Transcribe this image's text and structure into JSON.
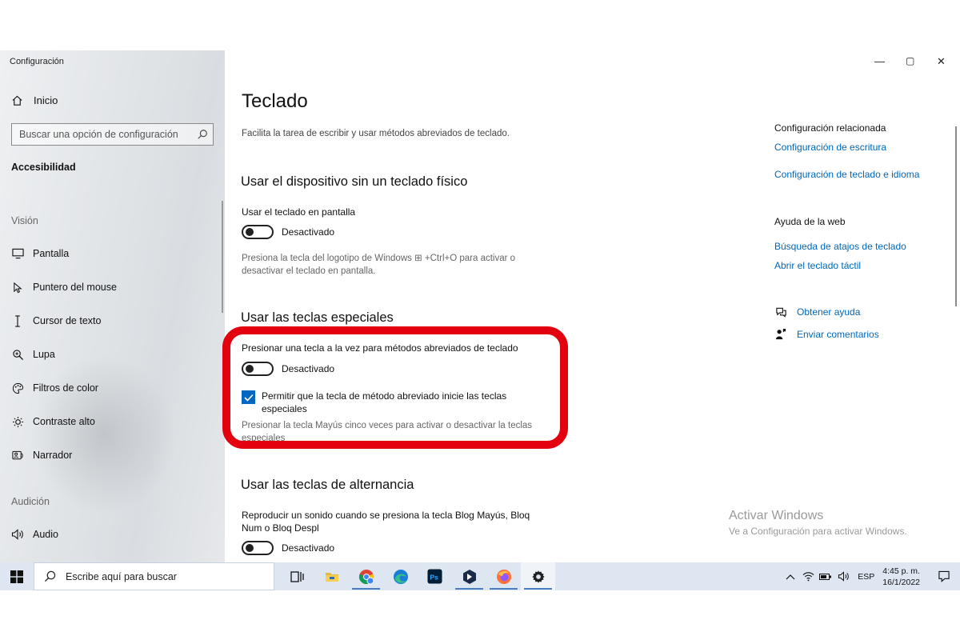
{
  "window": {
    "title": "Configuración",
    "controls": {
      "minimize": "—",
      "maximize": "▢",
      "close": "✕"
    }
  },
  "sidebar": {
    "home_label": "Inicio",
    "search_placeholder": "Buscar una opción de configuración",
    "current_section": "Accesibilidad",
    "groups": [
      {
        "label": "Visión",
        "items": [
          "Pantalla",
          "Puntero del mouse",
          "Cursor de texto",
          "Lupa",
          "Filtros de color",
          "Contraste alto",
          "Narrador"
        ]
      },
      {
        "label": "Audición",
        "items": [
          "Audio"
        ]
      }
    ]
  },
  "main": {
    "title": "Teclado",
    "description": "Facilita la tarea de escribir y usar métodos abreviados de teclado.",
    "sections": [
      {
        "heading": "Usar el dispositivo sin un teclado físico",
        "setting_label": "Usar el teclado en pantalla",
        "toggle_state": "Desactivado",
        "help": "Presiona la tecla del logotipo de Windows ⊞ +Ctrl+O para activar o desactivar el teclado en pantalla."
      },
      {
        "heading": "Usar las teclas especiales",
        "setting_label": "Presionar una tecla a la vez para métodos abreviados de teclado",
        "toggle_state": "Desactivado",
        "checkbox_label": "Permitir que la tecla de método abreviado inicie las teclas especiales",
        "checkbox_checked": true,
        "help": "Presionar la tecla Mayús cinco veces para activar o desactivar la teclas especiales"
      },
      {
        "heading": "Usar las teclas de alternancia",
        "setting_label": "Reproducir un sonido cuando se presiona la tecla Blog Mayús, Bloq Num o Bloq Despl",
        "toggle_state": "Desactivado"
      }
    ]
  },
  "related": {
    "heading": "Configuración relacionada",
    "links": [
      "Configuración de escritura",
      "Configuración de teclado e idioma"
    ],
    "web_heading": "Ayuda de la web",
    "web_links": [
      "Búsqueda de atajos de teclado",
      "Abrir el teclado táctil"
    ],
    "get_help": "Obtener ayuda",
    "feedback": "Enviar comentarios"
  },
  "watermark": {
    "line1": "Activar Windows",
    "line2": "Ve a Configuración para activar Windows."
  },
  "taskbar": {
    "search_placeholder": "Escribe aquí para buscar",
    "apps": [
      "task-view",
      "file-explorer",
      "chrome",
      "edge",
      "photoshop",
      "app-blue",
      "firefox",
      "settings"
    ],
    "language": "ESP",
    "time": "4:45 p. m.",
    "date": "16/1/2022"
  },
  "colors": {
    "accent": "#0067c0",
    "link": "#0067b8",
    "highlight": "#e3000f",
    "taskbar": "#dde6f1"
  }
}
